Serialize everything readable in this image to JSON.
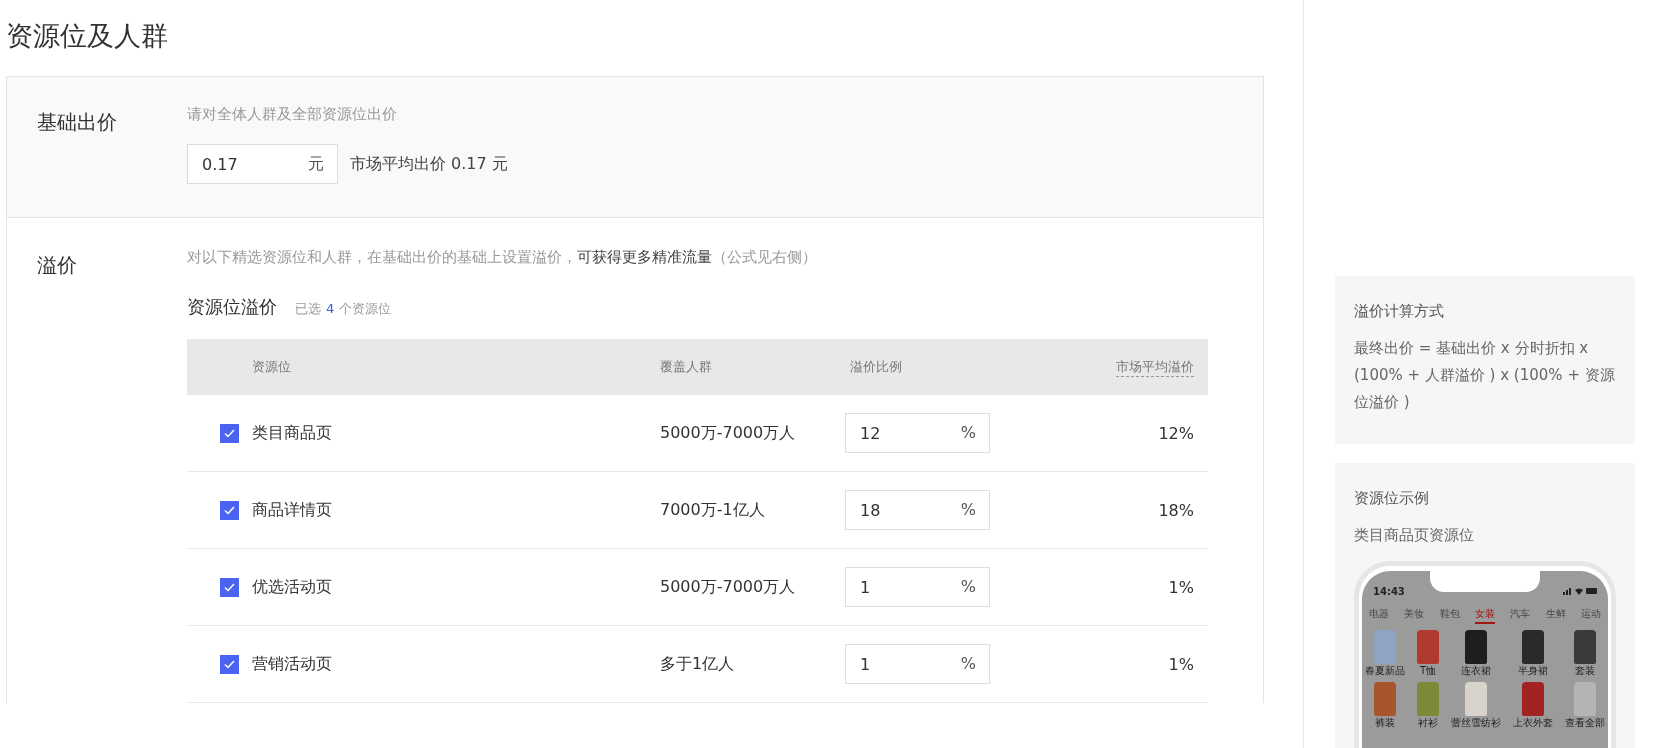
{
  "page_title": "资源位及人群",
  "base_bid": {
    "label": "基础出价",
    "hint": "请对全体人群及全部资源位出价",
    "value": "0.17",
    "unit": "元",
    "market_avg": "市场平均出价 0.17 元"
  },
  "premium": {
    "label": "溢价",
    "desc_lead": "对以下精选资源位和人群，在基础出价的基础上设置溢价，",
    "desc_emphasis": "可获得更多精准流量",
    "desc_tail": "（公式见右侧）",
    "slot_title": "资源位溢价",
    "selected_prefix": "已选",
    "selected_count": "4",
    "selected_suffix": "个资源位",
    "table": {
      "columns": [
        "资源位",
        "覆盖人群",
        "溢价比例",
        "市场平均溢价"
      ],
      "rows": [
        {
          "checked": true,
          "name": "类目商品页",
          "audience": "5000万-7000万人",
          "ratio": "12",
          "unit": "%",
          "market_avg": "12%"
        },
        {
          "checked": true,
          "name": "商品详情页",
          "audience": "7000万-1亿人",
          "ratio": "18",
          "unit": "%",
          "market_avg": "18%"
        },
        {
          "checked": true,
          "name": "优选活动页",
          "audience": "5000万-7000万人",
          "ratio": "1",
          "unit": "%",
          "market_avg": "1%"
        },
        {
          "checked": true,
          "name": "营销活动页",
          "audience": "多于1亿人",
          "ratio": "1",
          "unit": "%",
          "market_avg": "1%"
        }
      ]
    }
  },
  "formula_card": {
    "title": "溢价计算方式",
    "text": "最终出价 = 基础出价 x 分时折扣 x (100% + 人群溢价 ) x (100% + 资源位溢价 )"
  },
  "example_card": {
    "title": "资源位示例",
    "subtitle": "类目商品页资源位",
    "phone": {
      "time": "14:43",
      "tabs": [
        {
          "label": "电器",
          "selected": false
        },
        {
          "label": "美妆",
          "selected": false
        },
        {
          "label": "鞋包",
          "selected": false
        },
        {
          "label": "女装",
          "selected": true
        },
        {
          "label": "汽车",
          "selected": false
        },
        {
          "label": "生鲜",
          "selected": false
        },
        {
          "label": "运动",
          "selected": false
        }
      ],
      "items": [
        {
          "label": "春夏新品",
          "color": "#8fa3c4"
        },
        {
          "label": "T恤",
          "color": "#b03a2e"
        },
        {
          "label": "连衣裙",
          "color": "#1e1e1e"
        },
        {
          "label": "半身裙",
          "color": "#2a2a2a"
        },
        {
          "label": "套装",
          "color": "#3a3a3a"
        },
        {
          "label": "裤装",
          "color": "#a8552f"
        },
        {
          "label": "衬衫",
          "color": "#7d8a3a"
        },
        {
          "label": "蕾丝雪纺衫",
          "color": "#d8d4cc"
        },
        {
          "label": "上衣外套",
          "color": "#a32222"
        },
        {
          "label": "查看全部",
          "color": "#b4b4b4"
        }
      ]
    }
  }
}
